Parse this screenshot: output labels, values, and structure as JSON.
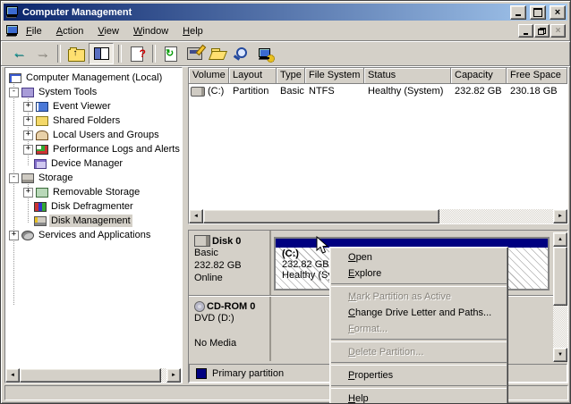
{
  "colors": {
    "chrome": "#D4D0C8",
    "titlebar_start": "#0A246A",
    "titlebar_end": "#A6CAF0",
    "primary_partition": "#000080",
    "selection_inactive": "#D4D0C8"
  },
  "window": {
    "title": "Computer Management"
  },
  "icons": {
    "scroll_up": "▲",
    "scroll_down": "▼",
    "scroll_left": "◄",
    "scroll_right": "►",
    "back_arrow": "←",
    "forward_arrow": "→",
    "up_arrow": "↑",
    "help_glyph": "?",
    "refresh_glyph": "↻",
    "close_glyph": "×",
    "toolbar_names": [
      "back",
      "forward",
      "up-one-level",
      "show-console-tree",
      "help",
      "refresh",
      "disk-signature",
      "open-folder",
      "search",
      "manage-computer"
    ]
  },
  "menubar": {
    "items": [
      {
        "u": "F",
        "post": "ile"
      },
      {
        "u": "A",
        "post": "ction"
      },
      {
        "u": "V",
        "post": "iew"
      },
      {
        "u": "W",
        "post": "indow"
      },
      {
        "u": "H",
        "post": "elp"
      }
    ]
  },
  "tree": {
    "items": [
      {
        "label": "Computer Management (Local)",
        "icon": "computer",
        "level": 0
      },
      {
        "label": "System Tools",
        "icon": "system-tools",
        "level": 1,
        "expander": "-"
      },
      {
        "label": "Event Viewer",
        "icon": "event-viewer",
        "level": 2,
        "expander": "+"
      },
      {
        "label": "Shared Folders",
        "icon": "shared-folders",
        "level": 2,
        "expander": "+"
      },
      {
        "label": "Local Users and Groups",
        "icon": "local-users-and-groups",
        "level": 2,
        "expander": "+"
      },
      {
        "label": "Performance Logs and Alerts",
        "icon": "performance-logs",
        "level": 2,
        "expander": "+"
      },
      {
        "label": "Device Manager",
        "icon": "device-manager",
        "level": 2
      },
      {
        "label": "Storage",
        "icon": "storage",
        "level": 1,
        "expander": "-"
      },
      {
        "label": "Removable Storage",
        "icon": "removable-storage",
        "level": 2,
        "expander": "+"
      },
      {
        "label": "Disk Defragmenter",
        "icon": "disk-defragmenter",
        "level": 2
      },
      {
        "label": "Disk Management",
        "icon": "disk-management",
        "level": 2,
        "selected": true
      },
      {
        "label": "Services and Applications",
        "icon": "services-and-applications",
        "level": 1,
        "expander": "+"
      }
    ]
  },
  "volume_list": {
    "columns": [
      "Volume",
      "Layout",
      "Type",
      "File System",
      "Status",
      "Capacity",
      "Free Space"
    ],
    "rows": [
      [
        "(C:)",
        "Partition",
        "Basic",
        "NTFS",
        "Healthy (System)",
        "232.82 GB",
        "230.18 GB"
      ]
    ]
  },
  "disk_view": {
    "disk0": {
      "label": "Disk 0",
      "type": "Basic",
      "capacity": "232.82 GB",
      "status": "Online"
    },
    "partition": {
      "name": "(C:)",
      "capacity": "232.82 GB",
      "status": "Healthy (System)"
    },
    "cdrom": {
      "label": "CD-ROM 0",
      "media": "DVD (D:)",
      "status": "No Media"
    },
    "legend_primary": "Primary partition"
  },
  "context_menu": {
    "items": [
      {
        "u": "O",
        "post": "pen",
        "enabled": true
      },
      {
        "u": "E",
        "post": "xplore",
        "enabled": true
      },
      {
        "u": "M",
        "post": "ark Partition as Active",
        "enabled": false
      },
      {
        "u": "C",
        "post": "hange Drive Letter and Paths...",
        "enabled": true
      },
      {
        "u": "F",
        "post": "ormat...",
        "enabled": false
      },
      {
        "u": "D",
        "post": "elete Partition...",
        "enabled": false
      },
      {
        "u": "P",
        "post": "roperties",
        "enabled": true
      },
      {
        "u": "H",
        "post": "elp",
        "enabled": true
      }
    ]
  }
}
